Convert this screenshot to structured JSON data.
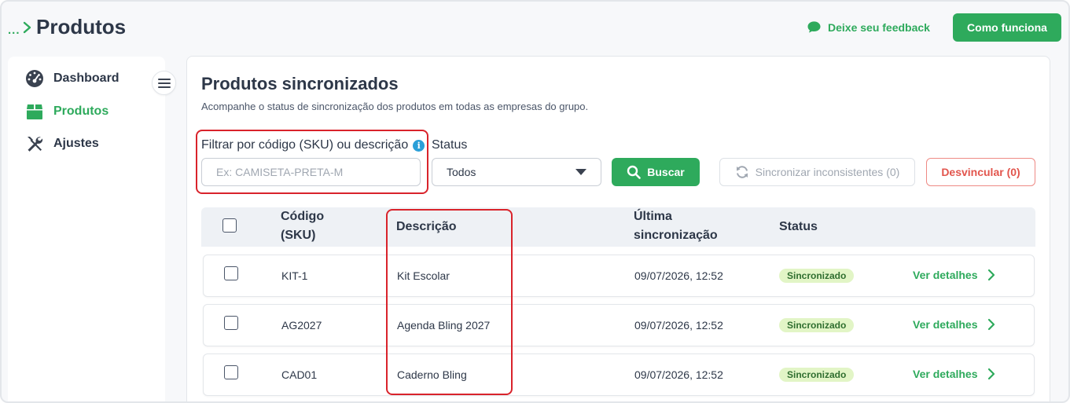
{
  "header": {
    "breadcrumb_dots": "...",
    "title": "Produtos",
    "feedback_label": "Deixe seu feedback",
    "how_it_works_label": "Como funciona"
  },
  "sidebar": {
    "items": [
      {
        "label": "Dashboard",
        "icon": "dashboard-gauge-icon",
        "active": false
      },
      {
        "label": "Produtos",
        "icon": "box-icon",
        "active": true
      },
      {
        "label": "Ajustes",
        "icon": "tools-icon",
        "active": false
      }
    ]
  },
  "main": {
    "title": "Produtos sincronizados",
    "subtitle": "Acompanhe o status de sincronização dos produtos em todas as empresas do grupo.",
    "filter": {
      "label": "Filtrar por código (SKU) ou descrição",
      "info": "i",
      "placeholder": "Ex: CAMISETA-PRETA-M",
      "value": ""
    },
    "status": {
      "label": "Status",
      "selected": "Todos"
    },
    "search_button": "Buscar",
    "sync_button": "Sincronizar inconsistentes (0)",
    "unlink_button": "Desvincular (0)",
    "table": {
      "headers": {
        "code_line1": "Código",
        "code_line2": "(SKU)",
        "description": "Descrição",
        "last_sync_line1": "Última",
        "last_sync_line2": "sincronização",
        "status": "Status"
      },
      "rows": [
        {
          "code": "KIT-1",
          "description": "Kit Escolar",
          "last_sync": "09/07/2026, 12:52",
          "status": "Sincronizado",
          "action": "Ver detalhes"
        },
        {
          "code": "AG2027",
          "description": "Agenda Bling 2027",
          "last_sync": "09/07/2026, 12:52",
          "status": "Sincronizado",
          "action": "Ver detalhes"
        },
        {
          "code": "CAD01",
          "description": "Caderno Bling",
          "last_sync": "09/07/2026, 12:52",
          "status": "Sincronizado",
          "action": "Ver detalhes"
        }
      ]
    }
  },
  "colors": {
    "brand_green": "#2eaa5c",
    "danger_red": "#e2554d",
    "highlight_red": "#d9232b",
    "badge_bg": "#e2f5c6"
  }
}
